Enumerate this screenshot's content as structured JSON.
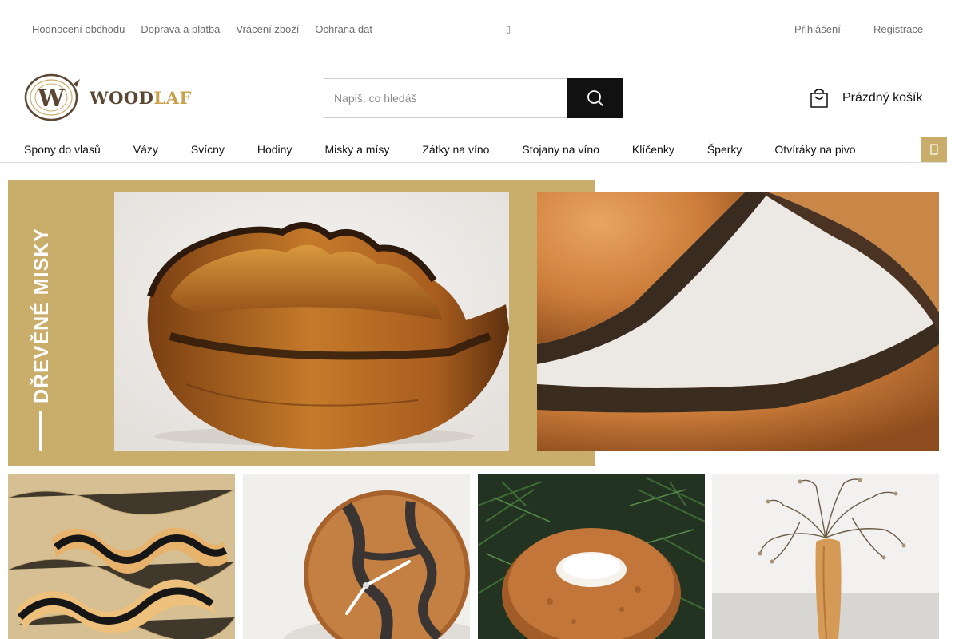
{
  "topbar": {
    "links": [
      "Hodnocení obchodu",
      "Doprava a platba",
      "Vrácení zboží",
      "Ochrana dat"
    ],
    "login": "Přihlášení",
    "register": "Registrace"
  },
  "brand": {
    "monogram": "W",
    "name_part1": "WOOD",
    "name_part2": "LAF",
    "color_wood": "#5a4632",
    "color_accent": "#c9ad6a"
  },
  "search": {
    "placeholder": "Napiš, co hledáš",
    "icon": "search-icon"
  },
  "cart": {
    "label": "Prázdný košík",
    "icon": "shopping-bag-icon"
  },
  "nav": {
    "items": [
      "Spony do vlasů",
      "Vázy",
      "Svícny",
      "Hodiny",
      "Misky a mísy",
      "Zátky na víno",
      "Stojany na víno",
      "Klíčenky",
      "Šperky",
      "Otvíráky na pivo"
    ],
    "more_icon": "more-icon"
  },
  "hero": {
    "title": "DŘEVĚNÉ MISKY"
  },
  "tiles": [
    "hair-clips-photo",
    "clock-photo",
    "candle-holder-photo",
    "vase-photo"
  ]
}
